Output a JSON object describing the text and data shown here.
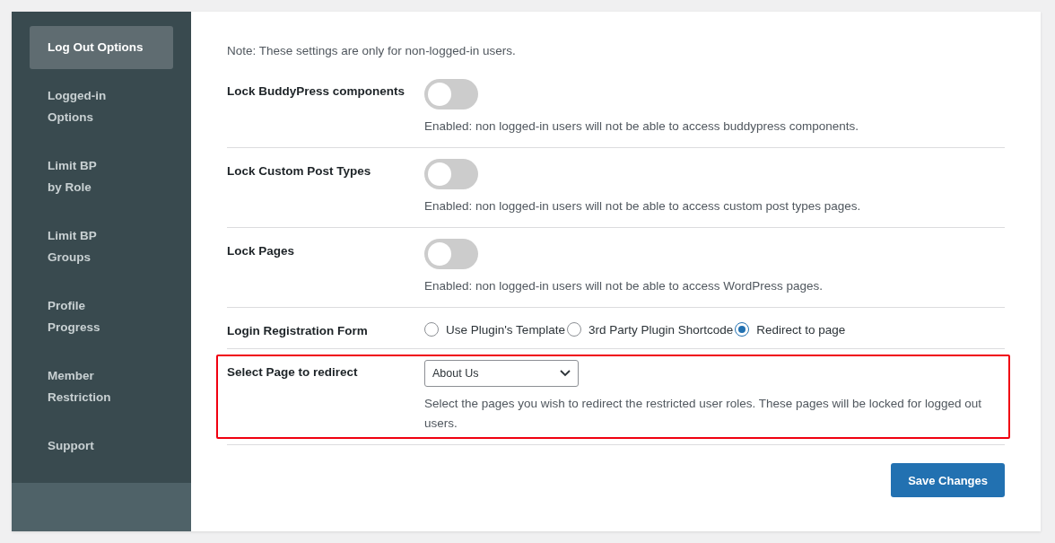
{
  "sidebar": {
    "items": [
      {
        "label": "Log Out Options",
        "selected": true
      },
      {
        "label": "Logged-in Options",
        "selected": false
      },
      {
        "label": "Limit BP by Role",
        "selected": false
      },
      {
        "label": "Limit BP Groups",
        "selected": false
      },
      {
        "label": "Profile Progress",
        "selected": false
      },
      {
        "label": "Member Restriction",
        "selected": false
      },
      {
        "label": "Support",
        "selected": false
      }
    ]
  },
  "note": "Note: These settings are only for non-logged-in users.",
  "settings": [
    {
      "kind": "toggle",
      "label": "Lock BuddyPress components",
      "on": false,
      "description": "Enabled: non logged-in users will not be able to access buddypress components.",
      "highlighted": false
    },
    {
      "kind": "toggle",
      "label": "Lock Custom Post Types",
      "on": false,
      "description": "Enabled: non logged-in users will not be able to access custom post types pages.",
      "highlighted": false
    },
    {
      "kind": "toggle",
      "label": "Lock Pages",
      "on": false,
      "description": "Enabled: non logged-in users will not be able to access WordPress pages.",
      "highlighted": false
    },
    {
      "kind": "radio",
      "label": "Login Registration Form",
      "options": [
        {
          "label": "Use Plugin's Template",
          "selected": false
        },
        {
          "label": "3rd Party Plugin Shortcode",
          "selected": false
        },
        {
          "label": "Redirect to page",
          "selected": true
        }
      ],
      "highlighted": false
    },
    {
      "kind": "select",
      "label": "Select Page to redirect",
      "value": "About Us",
      "description": "Select the pages you wish to redirect the restricted user roles. These pages will be locked for logged out users.",
      "highlighted": true
    }
  ],
  "save_button": "Save Changes"
}
